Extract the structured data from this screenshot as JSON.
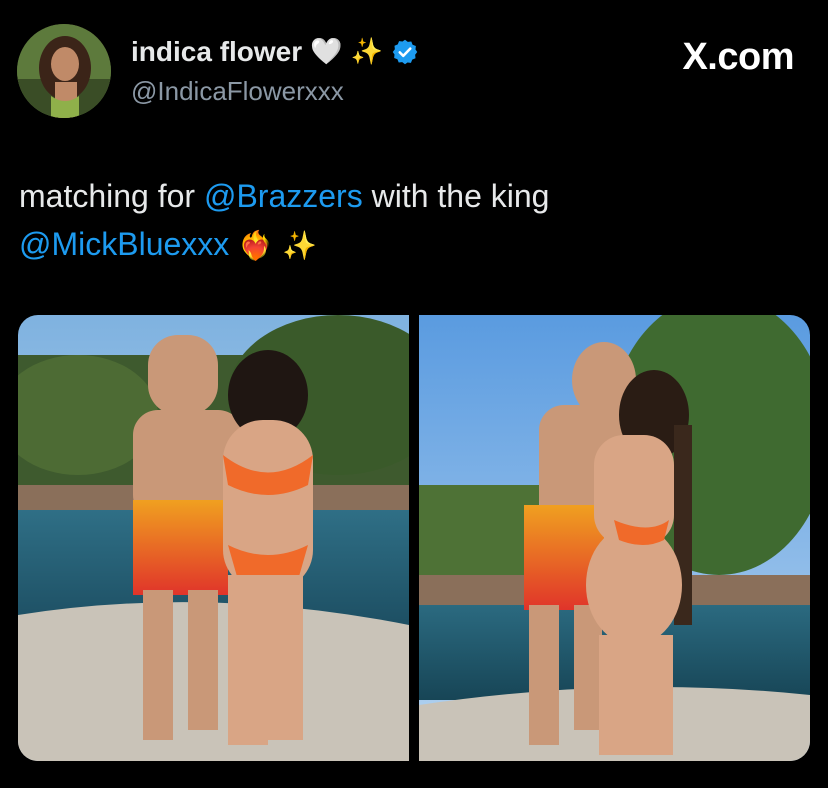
{
  "author": {
    "display_name": "indica flower",
    "heart_emoji": "🤍",
    "sparkle_emoji": "✨",
    "handle": "@IndicaFlowerxxx"
  },
  "brand": "X.com",
  "tweet": {
    "text_1": "matching for ",
    "mention_1": "@Brazzers",
    "text_2": " with the king",
    "mention_2": "@MickBluexxx",
    "emoji_1": "❤️‍🔥",
    "emoji_2": "✨"
  },
  "media": {
    "count": 2
  },
  "colors": {
    "background": "#000000",
    "text": "#e7e9ea",
    "secondary": "#8b98a5",
    "link": "#1d9bf0",
    "verified": "#1d9bf0"
  },
  "icons": {
    "verified": "verified-badge-icon"
  }
}
